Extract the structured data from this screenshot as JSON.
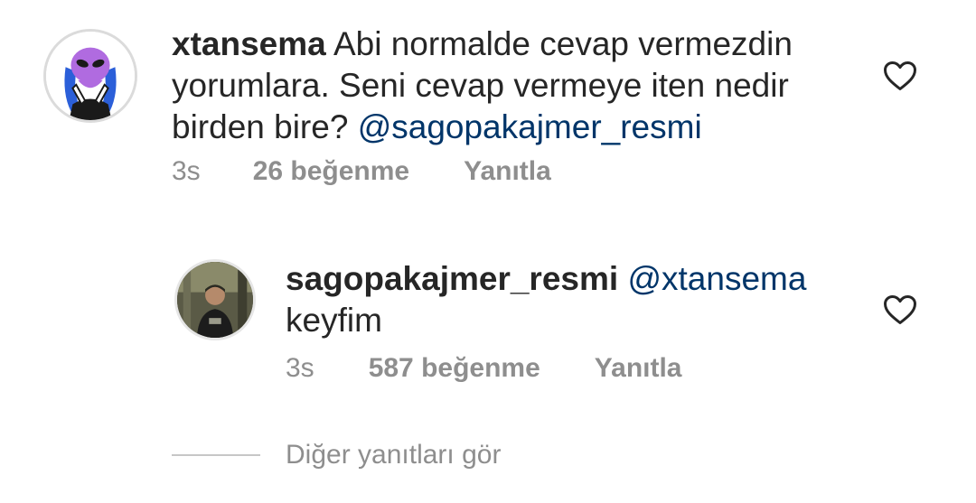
{
  "comments": [
    {
      "username": "xtansema",
      "text": " Abi normalde cevap vermezdin yorumlara. Seni cevap vermeye iten nedir birden bire? ",
      "mention": "@sagopakajmer_resmi",
      "time": "3s",
      "likes": "26 beğenme",
      "reply_label": "Yanıtla",
      "avatar_icon": "alien-avatar-icon"
    },
    {
      "username": "sagopakajmer_resmi",
      "mention": "@xtansema",
      "text": "keyfim",
      "time": "3s",
      "likes": "587 beğenme",
      "reply_label": "Yanıtla",
      "avatar_icon": "person-photo-avatar-icon"
    }
  ],
  "view_replies": {
    "label": "Diğer yanıtları gör"
  },
  "colors": {
    "text": "#262626",
    "mention": "#003569",
    "meta": "#8e8e8e",
    "divider": "#c7c7c7"
  }
}
